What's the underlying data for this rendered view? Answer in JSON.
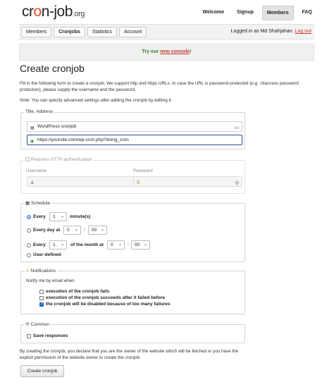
{
  "header": {
    "logo_main": "cr",
    "logo_o": "o",
    "logo_rest": "n-job",
    "logo_org": ".org",
    "nav": [
      "Welcome",
      "Signup",
      "Members",
      "FAQ"
    ]
  },
  "subnav": {
    "tabs": [
      "Members",
      "Cronjobs",
      "Statistics",
      "Account"
    ],
    "login_text": "Logged in as Md Shahjahan.",
    "logout": "Log out"
  },
  "banner": {
    "prefix": "Try our ",
    "link": "new console",
    "suffix": "!"
  },
  "page_title": "Create cronjob",
  "intro": "Fill in the following form to create a cronjob. We support http and https URLs. In case the URL is password-protected (e.g. .htaccess password protection), please supply the username and the password.",
  "note_label": "Note:",
  "note_text": " You can specify advanced settings after adding the cronjob by editing it.",
  "title_address": {
    "legend": "Title, Address",
    "title_value": "WordPress cronjob",
    "url_value": "https://yoursite.com/wp-cron.php?doing_cron"
  },
  "auth": {
    "legend": "Requires HTTP authentication",
    "username_label": "Username",
    "password_label": "Password"
  },
  "schedule": {
    "legend": "Schedule",
    "every_label": "Every",
    "every_value": "1",
    "minutes_label": "minute(s)",
    "every_day_label": "Every day at",
    "day_hour": "0",
    "day_min": "00",
    "every2_label": "Every",
    "month_day": "1.",
    "of_month_label": "of the month at",
    "month_hour": "0",
    "month_min": "00",
    "user_defined": "User-defined",
    "colon": ":"
  },
  "notifications": {
    "legend": "Notifications",
    "intro": "Notify me by email when",
    "items": [
      "execution of the cronjob fails",
      "execution of the cronjob succeeds after it failed before",
      "the cronjob will be disabled because of too many failures"
    ]
  },
  "common": {
    "legend": "Common",
    "save_responses": "Save responses"
  },
  "declaration": "By creating the cronjob, you declare that you are the owner of the website which will be fetched or you have the explicit permission of the website owner to create the cronjob.",
  "create_button": "Create cronjob"
}
